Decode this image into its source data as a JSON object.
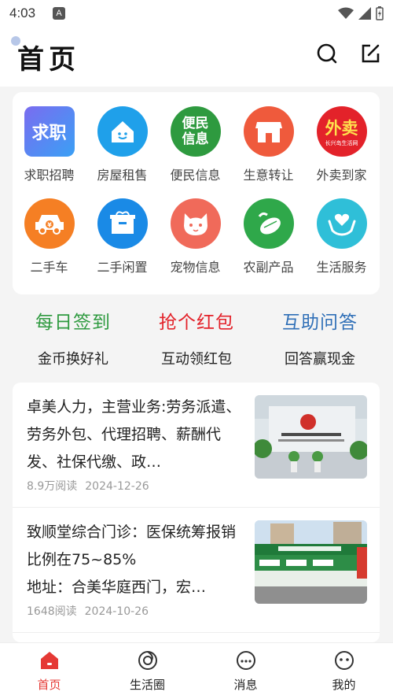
{
  "status": {
    "time": "4:03",
    "notif": "A"
  },
  "header": {
    "title": "首页"
  },
  "grid": [
    {
      "label": "求职招聘",
      "icon": "job-icon",
      "icon_text": "求职",
      "color": "#5b7cf6"
    },
    {
      "label": "房屋租售",
      "icon": "house-icon",
      "color": "#1fa0ea"
    },
    {
      "label": "便民信息",
      "icon": "info-icon",
      "icon_text": "便民\n信息",
      "color": "#2e9a3f"
    },
    {
      "label": "生意转让",
      "icon": "shop-icon",
      "color": "#ef5a3c"
    },
    {
      "label": "外卖到家",
      "icon": "delivery-icon",
      "icon_text": "外卖",
      "icon_subtext": "长兴岛生活网",
      "color": "#e3222a"
    },
    {
      "label": "二手车",
      "icon": "car-icon",
      "color": "#f57f24"
    },
    {
      "label": "二手闲置",
      "icon": "box-icon",
      "color": "#1a8ae6"
    },
    {
      "label": "宠物信息",
      "icon": "cat-icon",
      "color": "#f06a5a"
    },
    {
      "label": "农副产品",
      "icon": "vegetable-icon",
      "color": "#2fa84a"
    },
    {
      "label": "生活服务",
      "icon": "heart-hand-icon",
      "color": "#2fbfd8"
    }
  ],
  "actions": [
    {
      "title": "每日签到",
      "sub": "金币换好礼",
      "color": "#2e9a3f"
    },
    {
      "title": "抢个红包",
      "sub": "互动领红包",
      "color": "#e3222a"
    },
    {
      "title": "互助问答",
      "sub": "回答赢现金",
      "color": "#2f6fb7"
    }
  ],
  "news": [
    {
      "title": "卓美人力，主营业务:劳务派遣、劳务外包、代理招聘、薪酬代发、社保代缴、政…",
      "reads": "8.9万阅读",
      "date": "2024-12-26"
    },
    {
      "title": "致顺堂综合门诊：医保统筹报销比例在75~85%\n地址：合美华庭西门，宏…",
      "reads": "1648阅读",
      "date": "2024-10-26"
    }
  ],
  "tabs": [
    {
      "label": "首页",
      "icon": "home-icon"
    },
    {
      "label": "生活圈",
      "icon": "circle-icon"
    },
    {
      "label": "消息",
      "icon": "message-icon"
    },
    {
      "label": "我的",
      "icon": "profile-icon"
    }
  ],
  "colors": {
    "accent": "#e53935"
  }
}
